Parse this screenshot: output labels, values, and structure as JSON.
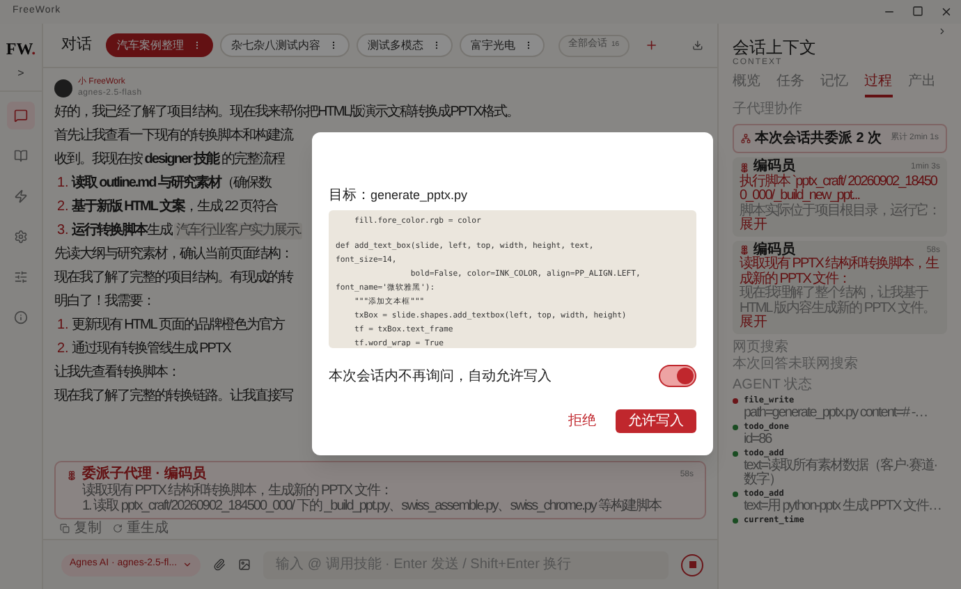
{
  "title_bar": {
    "app_name": "FreeWork"
  },
  "rail": {
    "logo": "FW",
    "logo_dot": ".",
    "expand": ">",
    "items": [
      {
        "selected": true
      },
      {
        "selected": false
      },
      {
        "selected": false
      },
      {
        "selected": false
      },
      {
        "selected": false
      },
      {
        "selected": false
      }
    ]
  },
  "conversation": {
    "label": "对话",
    "tabs": [
      {
        "label": "汽车案例整理",
        "selected": true
      },
      {
        "label": "杂七杂八测试内容",
        "selected": false
      },
      {
        "label": "测试多模态",
        "selected": false
      },
      {
        "label": "富宇光电",
        "selected": false
      }
    ],
    "all_sessions": {
      "label": "全部会话",
      "count": "16"
    }
  },
  "message": {
    "sender": "小 FreeWork",
    "model": "agnes-2.5-flash",
    "blocks": [
      {
        "kind": "p",
        "text": "好的，我已经了解了项目结构。现在我来帮你把HTML版演示文稿转换成PPTX格式。"
      },
      {
        "kind": "p",
        "text": "首先让我查看一下现有的转换脚本和构建流"
      },
      {
        "kind": "p",
        "text": "收到。我现在按 **designer 技能** 的完整流程"
      },
      {
        "kind": "li",
        "number": "1.",
        "text": "**读取 outline.md 与研究素材**（确保数"
      },
      {
        "kind": "li",
        "number": "2.",
        "text": "**基于新版 HTML 文案**，生成 22 页符合"
      },
      {
        "kind": "li",
        "number": "3.",
        "text": "**运行转换脚本**生成",
        "chip": "汽车行业客户实力展示."
      },
      {
        "kind": "p",
        "text": "先读大纲与研究素材，确认当前页面结构："
      },
      {
        "kind": "p",
        "text": "现在我了解了完整的项目结构。有现成的转"
      },
      {
        "kind": "p",
        "text": "明白了！我需要："
      },
      {
        "kind": "li",
        "number": "1.",
        "text": "更新现有 HTML 页面的品牌橙色为官方"
      },
      {
        "kind": "li",
        "number": "2.",
        "text": "通过现有转换管线生成 PPTX"
      },
      {
        "kind": "p",
        "text": "让我先查看转换脚本："
      },
      {
        "kind": "p",
        "text": "现在我了解了完整的转换链路。让我直接写"
      }
    ]
  },
  "delegate": {
    "title": "委派子代理 · 编码员",
    "time": "58s",
    "lines": [
      "读取现有 PPTX 结构和转换脚本，生成新的 PPTX 文件：",
      "1. 读取 pptx_craft/20260902_184500_000/ 下的 _build_ppt.py、swiss_assemble.py、swiss_chrome.py 等构建脚本"
    ]
  },
  "actions": [
    "复制",
    "重生成"
  ],
  "composer": {
    "model": "Agnes AI · agnes-2.5-fl...",
    "placeholder": "输入 @ 调用技能 · Enter 发送 / Shift+Enter 换行"
  },
  "context_panel": {
    "title": "会话上下文",
    "subtitle": "CONTEXT",
    "tabs": [
      {
        "label": "概览",
        "selected": false
      },
      {
        "label": "任务",
        "selected": false
      },
      {
        "label": "记忆",
        "selected": false
      },
      {
        "label": "过程",
        "selected": true
      },
      {
        "label": "产出",
        "selected": false
      }
    ],
    "section": "子代理协作",
    "summary": {
      "label": "本次会话共委派 2 次",
      "total": "累计 2min 1s"
    },
    "agents": [
      {
        "name": "编码员",
        "time": "1min 3s",
        "task": "执行脚本 `pptx_craft/ 20260902_184500_000/_build_new_ppt...",
        "note": "脚本实际位于项目根目录，运行它：",
        "expand": "展开"
      },
      {
        "name": "编码员",
        "time": "58s",
        "task": "读取现有 PPTX 结构和转换脚本，生成新的 PPTX 文件：",
        "note": "现在我理解了整个结构，让我基于 HTML 版内容生成新的 PPTX 文件。",
        "expand": "展开"
      }
    ],
    "web_search": {
      "title": "网页搜索",
      "note": "本次回答未联网搜索"
    },
    "agent_status": {
      "title": "AGENT 状态",
      "items": [
        {
          "name": "file_write",
          "detail": "path=generate_pptx.py content=# -…",
          "color": "#6a1519"
        },
        {
          "name": "todo_done",
          "detail": "id=86",
          "color": "#1a4c22"
        },
        {
          "name": "todo_add",
          "detail": "text=读取所有素材数据（客户·赛道·数字）",
          "color": "#1a4c22"
        },
        {
          "name": "todo_add",
          "detail": "text=用 python-pptx 生成 PPTX 文件…",
          "color": "#1a4c22"
        },
        {
          "name": "current_time",
          "color": "#1a4c22"
        }
      ]
    }
  },
  "dialog": {
    "target_label": "目标：",
    "target": "generate_pptx.py",
    "code": [
      "    fill.fore_color.rgb = color",
      "def add_text_box(slide, left, top, width, height, text,",
      "font_size=14,",
      "                bold=False, color=INK_COLOR, align=PP_ALIGN.LEFT,",
      "font_name='微软雅黑'):",
      "    \"\"\"添加文本框\"\"\"",
      "    txBox = slide.shapes.add_textbox(left, top, width, height)",
      "    tf = txBox.text_frame",
      "    tf.word_wrap = True"
    ],
    "auto_allow": {
      "label": "本次会话内不再询问，自动允许写入",
      "on": true
    },
    "buttons": [
      {
        "kind": "secondary",
        "label": "拒绝"
      },
      {
        "kind": "primary",
        "label": "允许写入"
      }
    ]
  }
}
